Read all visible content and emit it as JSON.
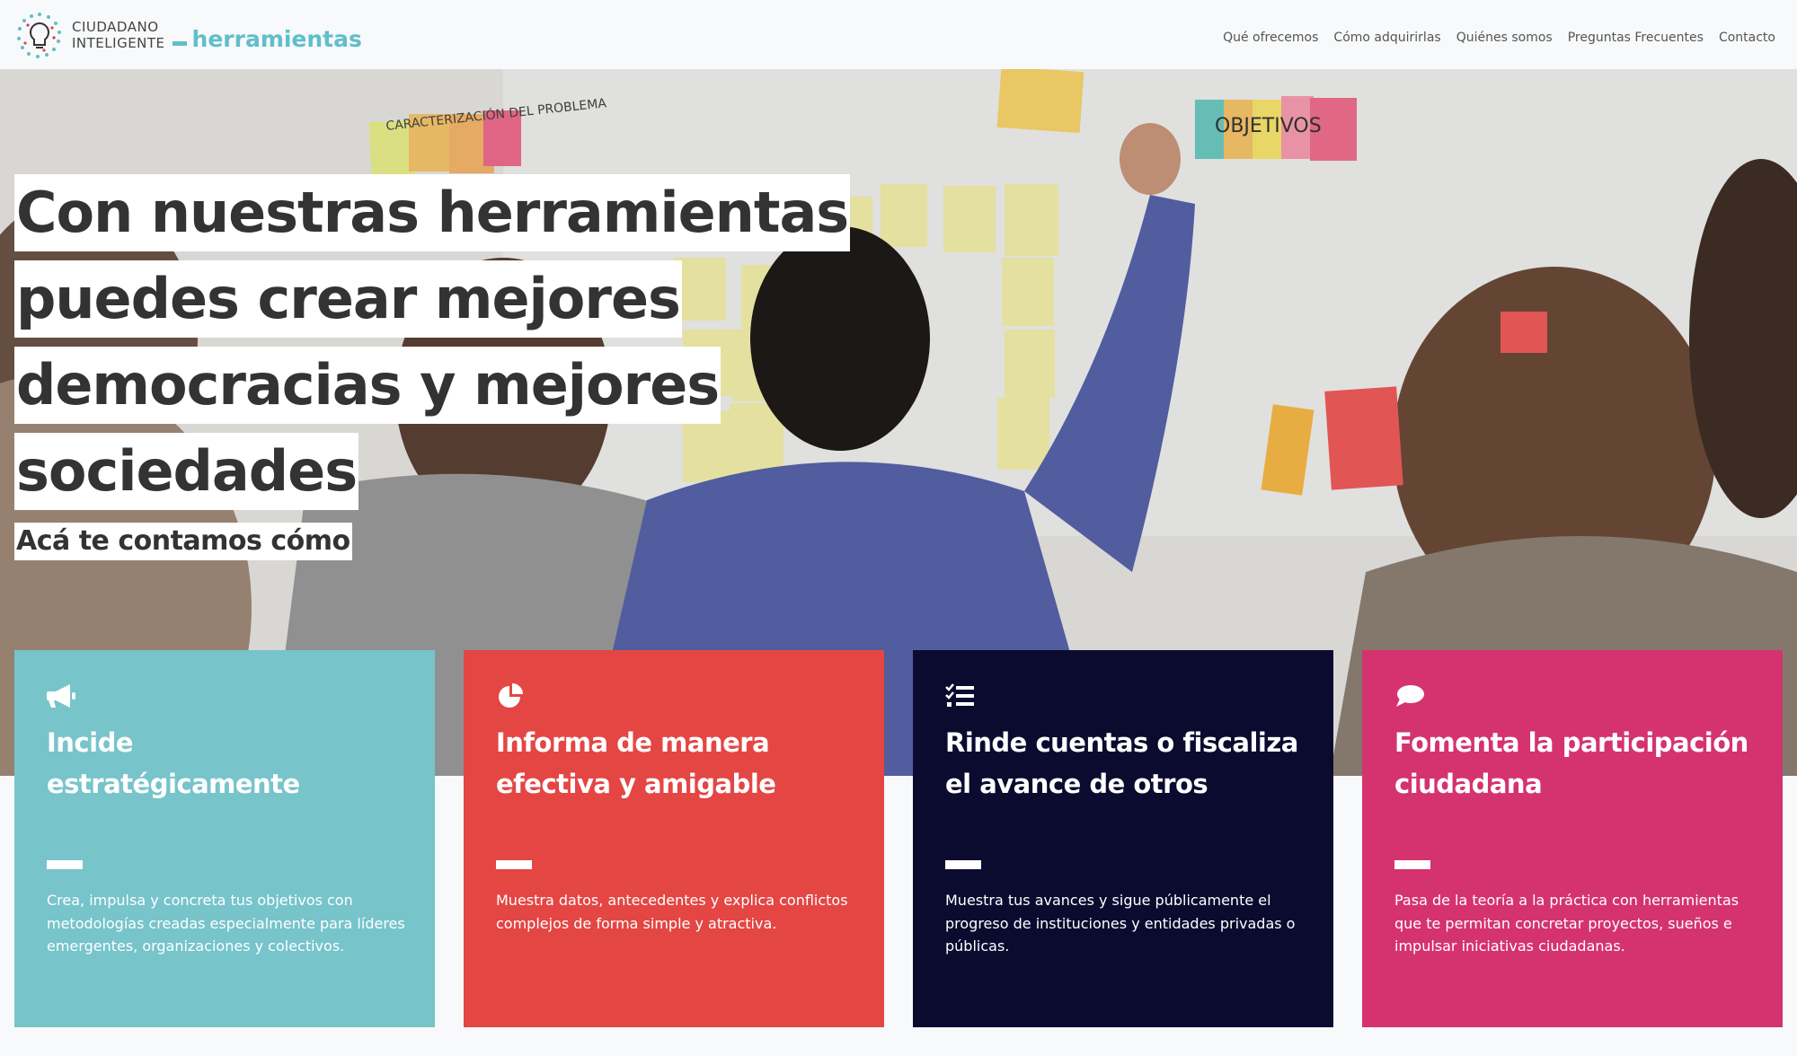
{
  "brand": {
    "line1": "CIUDADANO",
    "line2": "INTELIGENTE",
    "tool": "herramientas",
    "accent": "#5fbfca"
  },
  "nav": {
    "items": [
      "Qué ofrecemos",
      "Cómo adquirirlas",
      "Quiénes somos",
      "Preguntas Frecuentes",
      "Contacto"
    ]
  },
  "hero": {
    "headline_lines": [
      "Con nuestras herramientas",
      "puedes crear mejores",
      "democracias y mejores",
      "sociedades"
    ],
    "subhead": "Acá te contamos cómo",
    "sticky_note_1": "CARACTERIZACIÓN DEL PROBLEMA",
    "sticky_note_2": "OBJETIVOS"
  },
  "cards": [
    {
      "icon": "megaphone-icon",
      "color": "#77c4cb",
      "title_lines": [
        "Incide",
        "estratégicamente"
      ],
      "text": "Crea, impulsa y concreta tus objetivos con metodologías creadas especialmente para líderes emergentes, organizaciones y colectivos."
    },
    {
      "icon": "pie-chart-icon",
      "color": "#e44644",
      "title_lines": [
        "Informa de manera",
        "efectiva y amigable"
      ],
      "text": "Muestra datos, antecedentes y explica conflictos complejos de forma simple y atractiva."
    },
    {
      "icon": "checklist-icon",
      "color": "#0a0b2f",
      "title_lines": [
        "Rinde cuentas o fiscaliza",
        "el avance de otros"
      ],
      "text": "Muestra tus avances y sigue públicamente el progreso de instituciones y entidades privadas o públicas."
    },
    {
      "icon": "speech-bubble-icon",
      "color": "#d4336f",
      "title_lines": [
        "Fomenta la participación",
        "ciudadana"
      ],
      "text": "Pasa de la teoría a la práctica con herramientas que te permitan concretar proyectos, sueños e impulsar iniciativas ciudadanas."
    }
  ]
}
